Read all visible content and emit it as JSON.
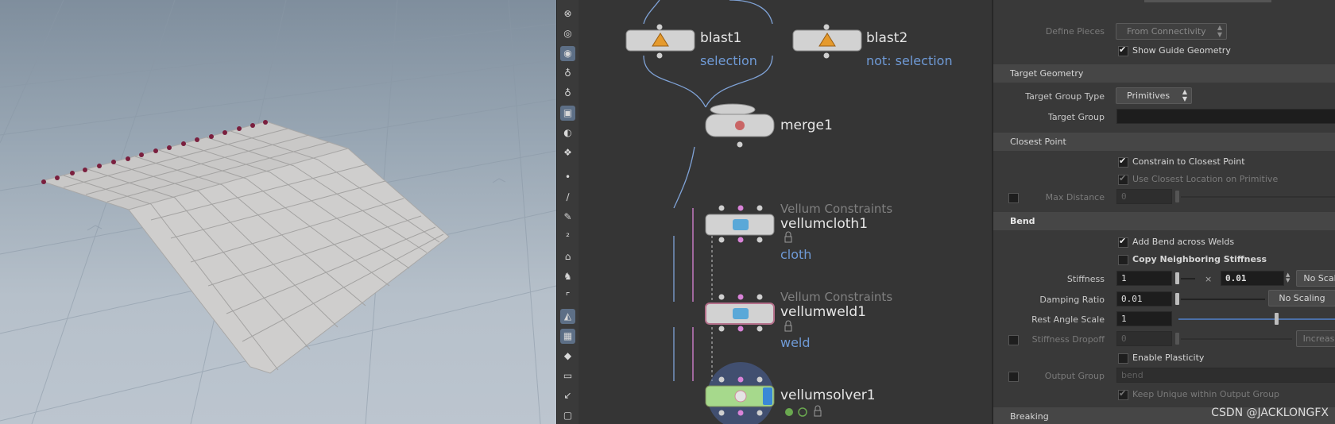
{
  "network": {
    "nodes": [
      {
        "id": "blast1",
        "name": "blast1",
        "sub": "selection"
      },
      {
        "id": "blast2",
        "name": "blast2",
        "sub": "not: selection"
      },
      {
        "id": "merge1",
        "name": "merge1"
      },
      {
        "id": "vellumcloth1",
        "type": "Vellum Constraints",
        "name": "vellumcloth1",
        "sub": "cloth"
      },
      {
        "id": "vellumweld1",
        "type": "Vellum Constraints",
        "name": "vellumweld1",
        "sub": "weld"
      },
      {
        "id": "vellumsolver1",
        "name": "vellumsolver1"
      }
    ]
  },
  "params": {
    "define_pieces": {
      "label": "Define Pieces",
      "value": "From Connectivity"
    },
    "show_guide": {
      "label": "Show Guide Geometry",
      "checked": true
    },
    "target_geometry": {
      "title": "Target Geometry"
    },
    "target_group_type": {
      "label": "Target Group Type",
      "value": "Primitives"
    },
    "target_group": {
      "label": "Target Group",
      "value": ""
    },
    "closest_point": {
      "title": "Closest Point"
    },
    "constrain_closest": {
      "label": "Constrain to Closest Point",
      "checked": true
    },
    "use_closest_location": {
      "label": "Use Closest Location on Primitive",
      "checked": true
    },
    "max_distance": {
      "label": "Max Distance",
      "value": "0"
    },
    "bend": {
      "title": "Bend"
    },
    "add_bend": {
      "label": "Add Bend across Welds",
      "checked": true
    },
    "copy_neighboring": {
      "label": "Copy Neighboring Stiffness",
      "checked": false
    },
    "stiffness": {
      "label": "Stiffness",
      "value": "1",
      "multiplier_symbol": "×",
      "multiplier": "0.01",
      "scaling": "No Scal"
    },
    "damping_ratio": {
      "label": "Damping Ratio",
      "value": "0.01",
      "scaling": "No Scaling"
    },
    "rest_angle_scale": {
      "label": "Rest Angle Scale",
      "value": "1"
    },
    "stiffness_dropoff": {
      "label": "Stiffness Dropoff",
      "value": "0",
      "mode": "Increasi"
    },
    "enable_plasticity": {
      "label": "Enable Plasticity",
      "checked": false
    },
    "output_group": {
      "label": "Output Group",
      "value": "bend"
    },
    "keep_unique": {
      "label": "Keep Unique within Output Group",
      "checked": true
    },
    "breaking": {
      "title": "Breaking"
    }
  },
  "toolbar": {
    "icons": [
      "close-icon",
      "sphere-icon",
      "light-icon",
      "bulb-icon",
      "bulb-outline-icon",
      "camera-icon",
      "eye-icon",
      "object-icon",
      "point-icon",
      "pencil-icon",
      "paint-icon",
      "number-icon",
      "brush-icon",
      "stamp-icon",
      "corner-icon",
      "sculpt-icon",
      "checker-icon",
      "diamond-icon",
      "image-icon",
      "arrow-icon",
      "square-icon"
    ]
  },
  "watermark": "CSDN @JACKLONGFX",
  "colors": {
    "wire": "#7fa2d6",
    "pink_wire": "#d983d8",
    "solver_green": "#a6d98c",
    "solver_blue": "#3a88d6",
    "accent": "#6f9ad6"
  }
}
